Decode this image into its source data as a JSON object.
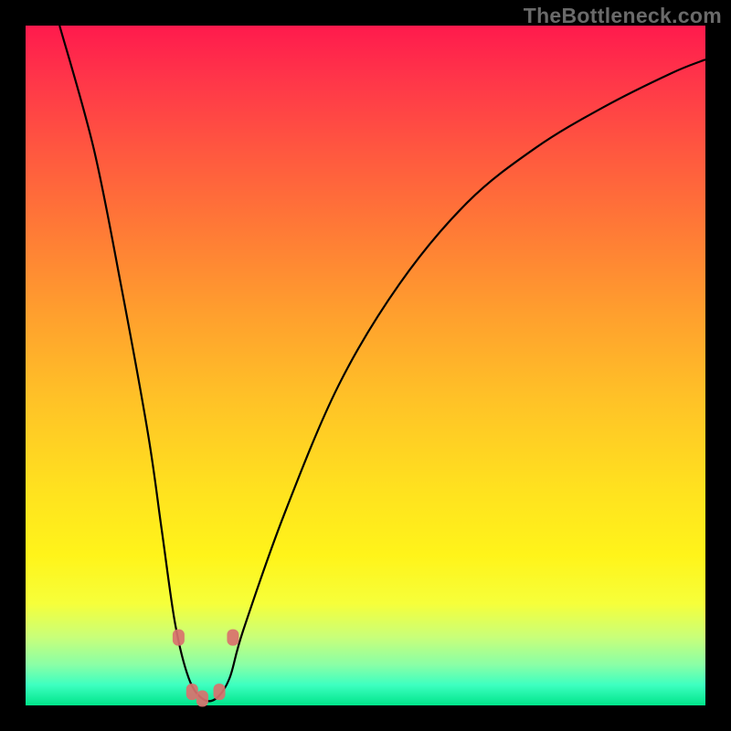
{
  "watermark": "TheBottleneck.com",
  "colors": {
    "frame_bg_top": "#ff1a4d",
    "frame_bg_bottom": "#00e58a",
    "curve_stroke": "#000000",
    "marker_fill": "#d9716e",
    "page_bg": "#000000"
  },
  "chart_data": {
    "type": "line",
    "title": "",
    "xlabel": "",
    "ylabel": "",
    "xlim": [
      0,
      100
    ],
    "ylim": [
      0,
      100
    ],
    "grid": false,
    "legend": false,
    "series": [
      {
        "name": "bottleneck-curve",
        "x": [
          5,
          10,
          14,
          18,
          20,
          22,
          24,
          26,
          28,
          30,
          32,
          38,
          46,
          55,
          65,
          75,
          85,
          95,
          100
        ],
        "values": [
          100,
          82,
          62,
          40,
          26,
          12,
          4,
          1,
          1,
          4,
          11,
          28,
          47,
          62,
          74,
          82,
          88,
          93,
          95
        ]
      }
    ],
    "markers": {
      "name": "highlighted-points",
      "x": [
        22.5,
        24.5,
        26.0,
        28.5,
        30.5
      ],
      "values": [
        10.0,
        2.0,
        1.0,
        2.0,
        10.0
      ]
    }
  }
}
